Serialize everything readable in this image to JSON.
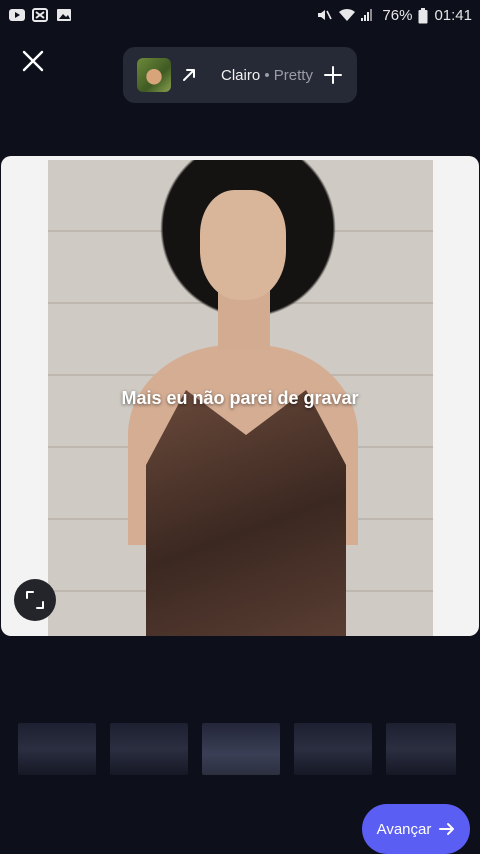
{
  "status_bar": {
    "battery": "76%",
    "time": "01:41",
    "left_icons": [
      "youtube-icon",
      "capcut-icon",
      "gallery-icon"
    ],
    "right_icons": [
      "mute-icon",
      "wifi-icon",
      "signal-icon",
      "battery-icon"
    ]
  },
  "music": {
    "title": "Clairo",
    "subtitle": " • Pretty"
  },
  "preview": {
    "caption": "Mais eu não parei de gravar"
  },
  "actions": {
    "next_label": "Avançar"
  },
  "colors": {
    "background": "#0d0f1a",
    "pill": "#262a36",
    "accent": "#5b5ef2"
  }
}
